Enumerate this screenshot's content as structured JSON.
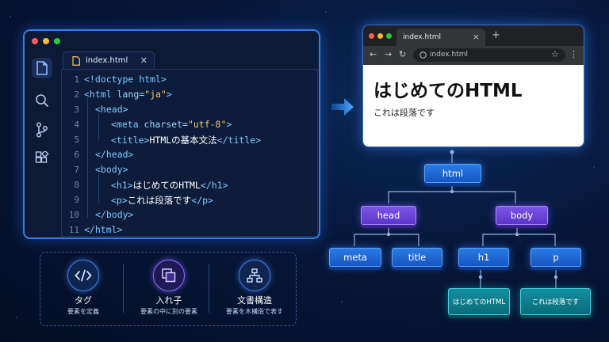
{
  "editor": {
    "tab_label": "index.html",
    "traffic_colors": [
      "#ff5f57",
      "#febc2e",
      "#28c840"
    ],
    "activity_icons": [
      "files-icon",
      "search-icon",
      "source-control-icon",
      "extensions-icon"
    ],
    "lines": [
      {
        "n": "1"
      },
      {
        "n": "2"
      },
      {
        "n": "3"
      },
      {
        "n": "4"
      },
      {
        "n": "5"
      },
      {
        "n": "6"
      },
      {
        "n": "7"
      },
      {
        "n": "8"
      },
      {
        "n": "9"
      },
      {
        "n": "10"
      },
      {
        "n": "11"
      }
    ],
    "code": {
      "l1": "<!doctype html>",
      "l2_open": "<html ",
      "l2_attr": "lang=",
      "l2_val": "\"ja\"",
      "l2_close": ">",
      "l3": "<head>",
      "l4_open": "<meta ",
      "l4_attr": "charset=",
      "l4_val": "\"utf-8\"",
      "l4_close": ">",
      "l5_open": "<title>",
      "l5_text": "HTMLの基本文法",
      "l5_close": "</title>",
      "l6": "</head>",
      "l7": "<body>",
      "l8_open": "<h1>",
      "l8_text": "はじめてのHTML",
      "l8_close": "</h1>",
      "l9_open": "<p>",
      "l9_text": "これは段落です",
      "l9_close": "</p>",
      "l10": "</body>",
      "l11": "</html>"
    }
  },
  "features": [
    {
      "icon": "code-icon",
      "title": "タグ",
      "subtitle": "要素を定義"
    },
    {
      "icon": "nesting-icon",
      "title": "入れ子",
      "subtitle": "要素の中に別の要素"
    },
    {
      "icon": "tree-structure-icon",
      "title": "文書構造",
      "subtitle": "要素を木構造で表す"
    }
  ],
  "browser": {
    "tab_label": "index.html",
    "address": "index.html",
    "heading": "はじめてのHTML",
    "paragraph": "これは段落です"
  },
  "tree": {
    "root": "html",
    "level1": [
      "head",
      "body"
    ],
    "level2": [
      "meta",
      "title",
      "h1",
      "p"
    ],
    "level3": [
      "はじめてのHTML",
      "これは段落です"
    ]
  },
  "colors": {
    "accent": "#3a7be0",
    "node_blue": "#1f6ad6",
    "node_purple": "#6a44d8",
    "node_teal": "#0f7d8c"
  }
}
